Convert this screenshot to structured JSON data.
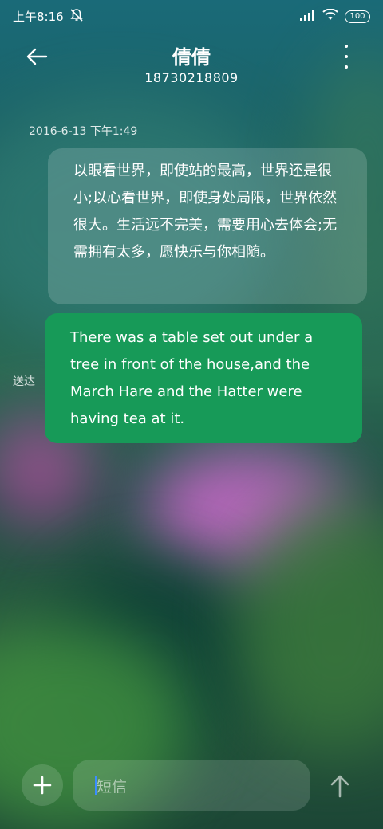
{
  "status_bar": {
    "time": "上午8:16",
    "battery": "100",
    "icons": [
      "mute-icon",
      "signal-icon",
      "wifi-icon",
      "battery-icon"
    ]
  },
  "header": {
    "contact_name": "倩倩",
    "phone_number": "18730218809",
    "icons": [
      "back-arrow-icon",
      "more-vert-icon"
    ]
  },
  "conversation": {
    "timestamp": "2016-6-13 下午1:49",
    "messages": [
      {
        "direction": "incoming",
        "text": "以眼看世界，即使站的最高，世界还是很小;以心看世界，即使身处局限，世界依然很大。生活远不完美，需要用心去体会;无需拥有太多，愿快乐与你相随。"
      },
      {
        "direction": "outgoing",
        "text": "There was a table set out under a tree in front of the house,and the March Hare and the Hatter were having tea at it.",
        "status": "送达"
      }
    ]
  },
  "composer": {
    "placeholder": "短信",
    "icons": [
      "plus-icon",
      "send-arrow-icon"
    ]
  },
  "colors": {
    "outgoing_bubble": "#179a58",
    "incoming_bubble": "rgba(255,255,255,0.16)",
    "cursor": "#3b8dff"
  }
}
